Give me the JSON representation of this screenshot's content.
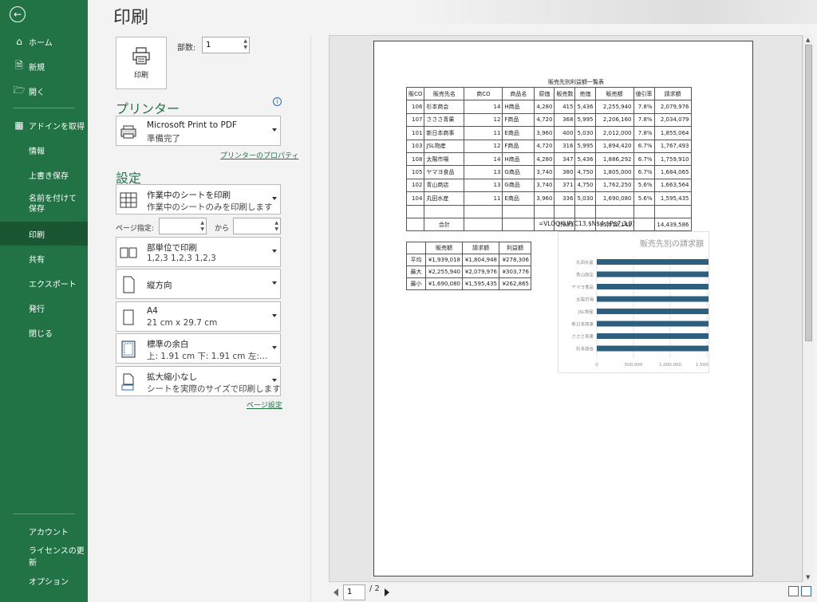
{
  "sidebar": {
    "items": [
      {
        "label": "ホーム",
        "icon": "home-icon"
      },
      {
        "label": "新規",
        "icon": "new-document-icon"
      },
      {
        "label": "開く",
        "icon": "folder-open-icon"
      },
      {
        "label": "アドインを取得",
        "icon": "addins-grid-icon"
      },
      {
        "label": "情報"
      },
      {
        "label": "上書き保存"
      },
      {
        "label": "名前を付けて保存"
      },
      {
        "label": "印刷"
      },
      {
        "label": "共有"
      },
      {
        "label": "エクスポート"
      },
      {
        "label": "発行"
      },
      {
        "label": "閉じる"
      },
      {
        "label": "アカウント"
      },
      {
        "label": "ライセンスの更新"
      },
      {
        "label": "オプション"
      }
    ]
  },
  "page_title": "印刷",
  "print_button": "印刷",
  "copies": {
    "label": "部数:",
    "value": "1"
  },
  "printer": {
    "heading": "プリンター",
    "name": "Microsoft Print to PDF",
    "status": "準備完了",
    "properties_link": "プリンターのプロパティ"
  },
  "settings": {
    "heading": "設定",
    "print_what": {
      "line1": "作業中のシートを印刷",
      "line2": "作業中のシートのみを印刷します"
    },
    "pages_label": "ページ指定:",
    "to_label": "から",
    "collate": {
      "line1": "部単位で印刷",
      "line2": "1,2,3    1,2,3    1,2,3"
    },
    "orientation": "縦方向",
    "paper": {
      "line1": "A4",
      "line2": "21 cm x 29.7 cm"
    },
    "margins": {
      "line1": "標準の余白",
      "line2": "上: 1.91 cm 下: 1.91 cm 左:…"
    },
    "scaling": {
      "line1": "拡大縮小なし",
      "line2": "シートを実際のサイズで印刷します"
    },
    "page_setup_link": "ページ設定"
  },
  "preview": {
    "sheet_title": "販売先別利益額一覧表",
    "headers": [
      "販CO",
      "販売先名",
      "商CO",
      "商品名",
      "原価",
      "販売数",
      "売価",
      "販売額",
      "値引率",
      "請求額"
    ],
    "rows": [
      [
        "106",
        "杉本商会",
        "14",
        "H商品",
        "4,280",
        "415",
        "5,436",
        "2,255,940",
        "7.8%",
        "2,079,976"
      ],
      [
        "107",
        "さささ青果",
        "12",
        "F商品",
        "4,720",
        "368",
        "5,995",
        "2,206,160",
        "7.8%",
        "2,034,079"
      ],
      [
        "101",
        "新日本商事",
        "11",
        "E商品",
        "3,960",
        "400",
        "5,030",
        "2,012,000",
        "7.8%",
        "1,855,064"
      ],
      [
        "103",
        "JSL物産",
        "12",
        "F商品",
        "4,720",
        "316",
        "5,995",
        "1,894,420",
        "6.7%",
        "1,767,493"
      ],
      [
        "108",
        "太陽市場",
        "14",
        "H商品",
        "4,280",
        "347",
        "5,436",
        "1,886,292",
        "6.7%",
        "1,759,910"
      ],
      [
        "105",
        "ヤマヨ食品",
        "13",
        "G商品",
        "3,740",
        "380",
        "4,750",
        "1,805,000",
        "6.7%",
        "1,684,065"
      ],
      [
        "102",
        "青山商店",
        "13",
        "G商品",
        "3,740",
        "371",
        "4,750",
        "1,762,250",
        "5.6%",
        "1,663,564"
      ],
      [
        "104",
        "丸田水産",
        "11",
        "E商品",
        "3,960",
        "336",
        "5,030",
        "1,690,080",
        "5.6%",
        "1,595,435"
      ]
    ],
    "total": {
      "label": "合計",
      "qty": "2,933",
      "sales": "15,512,142",
      "billing": "14,439,586"
    },
    "formula": "=VLOOKUP(C13,$N$4:$P$7,3,0)",
    "summary": {
      "headers": [
        "販売額",
        "請求額",
        "利益額"
      ],
      "rows": [
        [
          "平均",
          "¥1,939,018",
          "¥1,804,948",
          "¥278,306"
        ],
        [
          "最大",
          "¥2,255,940",
          "¥2,079,976",
          "¥303,776"
        ],
        [
          "最小",
          "¥1,690,080",
          "¥1,595,435",
          "¥262,865"
        ]
      ]
    }
  },
  "nav": {
    "page": "1",
    "total": "/ 2"
  },
  "chart_data": {
    "type": "bar",
    "orientation": "horizontal",
    "title": "販売先別の請求額",
    "categories": [
      "杉本商会",
      "さささ青果",
      "新日本商事",
      "JSL物産",
      "太陽市場",
      "ヤマヨ食品",
      "青山商店",
      "丸田水産"
    ],
    "values": [
      2079976,
      2034079,
      1855064,
      1767493,
      1759910,
      1684065,
      1663564,
      1595435
    ],
    "xticks": [
      "0",
      "500,000",
      "1,000,000",
      "1,500,000",
      "2,000,000"
    ],
    "xlim": [
      0,
      2000000
    ],
    "grid": true,
    "bar_color": "#2e5f7e"
  },
  "colors": {
    "accent": "#217346",
    "sidebar_active": "#1a5632"
  }
}
